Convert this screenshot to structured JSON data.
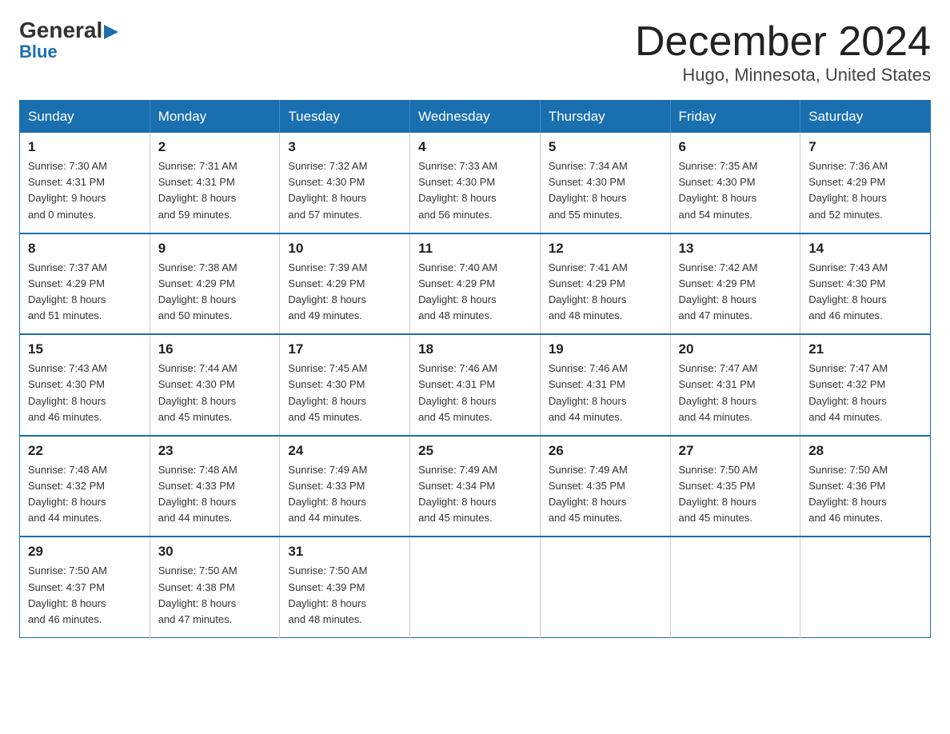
{
  "logo": {
    "general": "General",
    "blue": "Blue",
    "arrow": "▶"
  },
  "header": {
    "month_year": "December 2024",
    "location": "Hugo, Minnesota, United States"
  },
  "days_of_week": [
    "Sunday",
    "Monday",
    "Tuesday",
    "Wednesday",
    "Thursday",
    "Friday",
    "Saturday"
  ],
  "weeks": [
    [
      {
        "day": "1",
        "sunrise": "7:30 AM",
        "sunset": "4:31 PM",
        "daylight": "9 hours and 0 minutes."
      },
      {
        "day": "2",
        "sunrise": "7:31 AM",
        "sunset": "4:31 PM",
        "daylight": "8 hours and 59 minutes."
      },
      {
        "day": "3",
        "sunrise": "7:32 AM",
        "sunset": "4:30 PM",
        "daylight": "8 hours and 57 minutes."
      },
      {
        "day": "4",
        "sunrise": "7:33 AM",
        "sunset": "4:30 PM",
        "daylight": "8 hours and 56 minutes."
      },
      {
        "day": "5",
        "sunrise": "7:34 AM",
        "sunset": "4:30 PM",
        "daylight": "8 hours and 55 minutes."
      },
      {
        "day": "6",
        "sunrise": "7:35 AM",
        "sunset": "4:30 PM",
        "daylight": "8 hours and 54 minutes."
      },
      {
        "day": "7",
        "sunrise": "7:36 AM",
        "sunset": "4:29 PM",
        "daylight": "8 hours and 52 minutes."
      }
    ],
    [
      {
        "day": "8",
        "sunrise": "7:37 AM",
        "sunset": "4:29 PM",
        "daylight": "8 hours and 51 minutes."
      },
      {
        "day": "9",
        "sunrise": "7:38 AM",
        "sunset": "4:29 PM",
        "daylight": "8 hours and 50 minutes."
      },
      {
        "day": "10",
        "sunrise": "7:39 AM",
        "sunset": "4:29 PM",
        "daylight": "8 hours and 49 minutes."
      },
      {
        "day": "11",
        "sunrise": "7:40 AM",
        "sunset": "4:29 PM",
        "daylight": "8 hours and 48 minutes."
      },
      {
        "day": "12",
        "sunrise": "7:41 AM",
        "sunset": "4:29 PM",
        "daylight": "8 hours and 48 minutes."
      },
      {
        "day": "13",
        "sunrise": "7:42 AM",
        "sunset": "4:29 PM",
        "daylight": "8 hours and 47 minutes."
      },
      {
        "day": "14",
        "sunrise": "7:43 AM",
        "sunset": "4:30 PM",
        "daylight": "8 hours and 46 minutes."
      }
    ],
    [
      {
        "day": "15",
        "sunrise": "7:43 AM",
        "sunset": "4:30 PM",
        "daylight": "8 hours and 46 minutes."
      },
      {
        "day": "16",
        "sunrise": "7:44 AM",
        "sunset": "4:30 PM",
        "daylight": "8 hours and 45 minutes."
      },
      {
        "day": "17",
        "sunrise": "7:45 AM",
        "sunset": "4:30 PM",
        "daylight": "8 hours and 45 minutes."
      },
      {
        "day": "18",
        "sunrise": "7:46 AM",
        "sunset": "4:31 PM",
        "daylight": "8 hours and 45 minutes."
      },
      {
        "day": "19",
        "sunrise": "7:46 AM",
        "sunset": "4:31 PM",
        "daylight": "8 hours and 44 minutes."
      },
      {
        "day": "20",
        "sunrise": "7:47 AM",
        "sunset": "4:31 PM",
        "daylight": "8 hours and 44 minutes."
      },
      {
        "day": "21",
        "sunrise": "7:47 AM",
        "sunset": "4:32 PM",
        "daylight": "8 hours and 44 minutes."
      }
    ],
    [
      {
        "day": "22",
        "sunrise": "7:48 AM",
        "sunset": "4:32 PM",
        "daylight": "8 hours and 44 minutes."
      },
      {
        "day": "23",
        "sunrise": "7:48 AM",
        "sunset": "4:33 PM",
        "daylight": "8 hours and 44 minutes."
      },
      {
        "day": "24",
        "sunrise": "7:49 AM",
        "sunset": "4:33 PM",
        "daylight": "8 hours and 44 minutes."
      },
      {
        "day": "25",
        "sunrise": "7:49 AM",
        "sunset": "4:34 PM",
        "daylight": "8 hours and 45 minutes."
      },
      {
        "day": "26",
        "sunrise": "7:49 AM",
        "sunset": "4:35 PM",
        "daylight": "8 hours and 45 minutes."
      },
      {
        "day": "27",
        "sunrise": "7:50 AM",
        "sunset": "4:35 PM",
        "daylight": "8 hours and 45 minutes."
      },
      {
        "day": "28",
        "sunrise": "7:50 AM",
        "sunset": "4:36 PM",
        "daylight": "8 hours and 46 minutes."
      }
    ],
    [
      {
        "day": "29",
        "sunrise": "7:50 AM",
        "sunset": "4:37 PM",
        "daylight": "8 hours and 46 minutes."
      },
      {
        "day": "30",
        "sunrise": "7:50 AM",
        "sunset": "4:38 PM",
        "daylight": "8 hours and 47 minutes."
      },
      {
        "day": "31",
        "sunrise": "7:50 AM",
        "sunset": "4:39 PM",
        "daylight": "8 hours and 48 minutes."
      },
      null,
      null,
      null,
      null
    ]
  ],
  "labels": {
    "sunrise": "Sunrise:",
    "sunset": "Sunset:",
    "daylight": "Daylight:"
  }
}
